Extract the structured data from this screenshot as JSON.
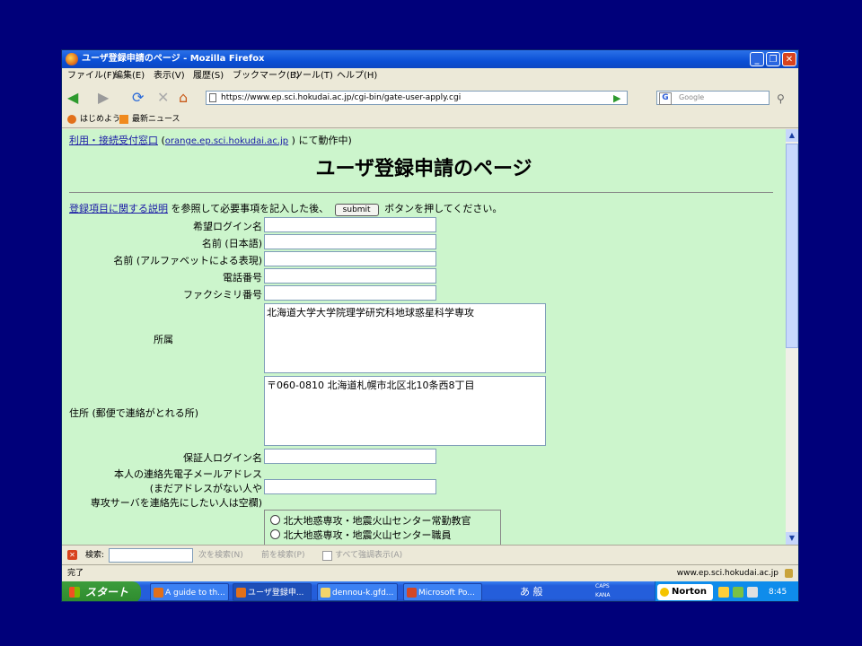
{
  "window": {
    "title": "ユーザ登録申請のページ - Mozilla Firefox",
    "min_glyph": "_",
    "max_glyph": "❐",
    "close_glyph": "✕"
  },
  "menu": [
    "ファイル(F)",
    "編集(E)",
    "表示(V)",
    "履歴(S)",
    "ブックマーク(B)",
    "ツール(T)",
    "ヘルプ(H)"
  ],
  "nav": {
    "url": "https://www.ep.sci.hokudai.ac.jp/cgi-bin/gate-user-apply.cgi",
    "search_placeholder": "Google",
    "back_icon": "◀",
    "forward_icon": "▶",
    "reload_icon": "⟳",
    "stop_icon": "✕",
    "home_icon": "⌂",
    "go_icon": "▶",
    "search_icon": "⚲"
  },
  "bookmarks": [
    "はじめよう",
    "最新ニュース"
  ],
  "page": {
    "reception_link": "利用・接続受付窓口",
    "host_prefix": "(",
    "host_link": "orange.ep.sci.hokudai.ac.jp",
    "host_suffix": ") にて動作中)",
    "heading": "ユーザ登録申請のページ",
    "instr_link": "登録項目に関する説明",
    "instr_text1": "を参照して必要事項を記入した後、",
    "submit_label": "submit",
    "instr_text2": "ボタンを押してください。",
    "fields": {
      "login": "希望ログイン名",
      "name_ja": "名前 (日本語)",
      "name_en": "名前 (アルファベットによる表現)",
      "phone": "電話番号",
      "fax": "ファクシミリ番号",
      "affiliation": "所属",
      "affiliation_value": "北海道大学大学院理学研究科地球惑星科学専攻",
      "address": "住所 (郵便で連絡がとれる所)",
      "address_value": "〒060-0810 北海道札幌市北区北10条西8丁目",
      "guarantor": "保証人ログイン名",
      "email_l1": "本人の連絡先電子メールアドレス",
      "email_l2": "(まだアドレスがない人や",
      "email_l3": "専攻サーバを連絡先にしたい人は空欄)"
    },
    "radio_options": [
      "北大地惑専攻・地震火山センター常勤教官",
      "北大地惑専攻・地震火山センター職員"
    ]
  },
  "findbar": {
    "close": "✕",
    "label": "検索:",
    "next": "次を検索(N)",
    "prev": "前を検索(P)",
    "highlight": "すべて強調表示(A)"
  },
  "status": {
    "left": "完了",
    "right": "www.ep.sci.hokudai.ac.jp"
  },
  "taskbar": {
    "start": "スタート",
    "tasks": [
      "A guide to th...",
      "ユーザ登録申...",
      "dennou-k.gfd...",
      "Microsoft Po..."
    ],
    "ime": "あ 般",
    "caps": "CAPS",
    "kana": "KANA",
    "norton": "Norton",
    "clock": "8:45"
  }
}
